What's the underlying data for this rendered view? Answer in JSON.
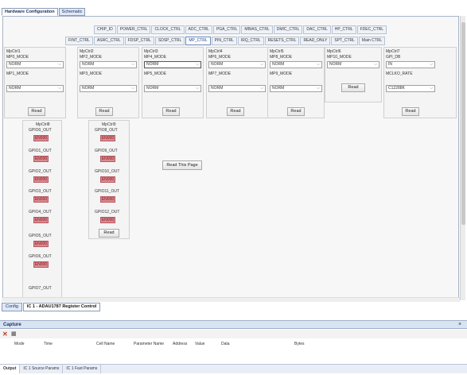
{
  "top_tabs": [
    "Hardware Configuration",
    "Schematic"
  ],
  "reg_tabs_row1": [
    "CHIP_ID",
    "POWER_CTRL",
    "CLOCK_CTRL",
    "ADC_CTRL",
    "PGA_CTRL",
    "MBIAS_CTRL",
    "DMIC_CTRL",
    "DAC_CTRL",
    "HP_CTRL",
    "FDEC_CTRL"
  ],
  "reg_tabs_row2": [
    "FINT_CTRL",
    "ASRC_CTRL",
    "FDSP_CTRL",
    "SDSP_CTRL",
    "MP_CTRL",
    "PIN_CTRL",
    "IRQ_CTRL",
    "RESETS_CTRL",
    "READ_ONLY",
    "SPT_CTRL",
    "Main CTRL"
  ],
  "mpctrl": [
    {
      "title": "MpCtrl1",
      "top_label": "MP0_MODE",
      "top_value": "NORM",
      "bot_label": "MP1_MODE",
      "bot_value": "NORM",
      "btn": "Read"
    },
    {
      "title": "MpCtrl2",
      "top_label": "MP2_MODE",
      "top_value": "NORM",
      "bot_label": "MP3_MODE",
      "bot_value": "NORM",
      "btn": "Read"
    },
    {
      "title": "MpCtrl3",
      "top_label": "MP4_MODE",
      "top_value": "NORM",
      "bot_label": "MP5_MODE",
      "bot_value": "NORM",
      "btn": "Read"
    },
    {
      "title": "MpCtrl4",
      "top_label": "MP6_MODE",
      "top_value": "NORM",
      "bot_label": "MP7_MODE",
      "bot_value": "NORM",
      "btn": "Read"
    },
    {
      "title": "MpCtrl5",
      "top_label": "MP8_MODE",
      "top_value": "NORM",
      "bot_label": "MP9_MODE",
      "bot_value": "NORM",
      "btn": "Read"
    },
    {
      "title": "MpCtrl6",
      "top_label": "MP10_MODE",
      "top_value": "NORM",
      "btn": "Read"
    },
    {
      "title": "MpCtrl7",
      "top_label": "GPI_DB",
      "top_value": "IN",
      "bot_label": "MCLKO_RATE",
      "bot_value": "C12288K",
      "btn": "Read"
    }
  ],
  "mpctrl8": {
    "title": "MpCtrl8",
    "items": [
      {
        "label": "GPIO0_OUT",
        "value": "EN000"
      },
      {
        "label": "GPIO1_OUT",
        "value": "EN000"
      },
      {
        "label": "GPIO2_OUT",
        "value": "EN000"
      },
      {
        "label": "GPIO3_OUT",
        "value": "EN000"
      },
      {
        "label": "GPIO4_OUT",
        "value": "EN000"
      },
      {
        "label": "GPIO5_OUT",
        "value": "EN000"
      },
      {
        "label": "GPIO6_OUT",
        "value": "EN000"
      },
      {
        "label": "GPIO7_OUT",
        "value": ""
      }
    ]
  },
  "mpctrl9": {
    "title": "MpCtrl9",
    "items": [
      {
        "label": "GPIO8_OUT",
        "value": "EN000"
      },
      {
        "label": "GPIO9_OUT",
        "value": "EN000"
      },
      {
        "label": "GPIO10_OUT",
        "value": "EN000"
      },
      {
        "label": "GPIO11_OUT",
        "value": "EN000"
      },
      {
        "label": "GPIO12_OUT",
        "value": "EN000"
      }
    ],
    "btn": "Read"
  },
  "read_page_btn": "Read This Page",
  "bottom_tabs": [
    "Config",
    "IC 1 - ADAU1787 Register Control"
  ],
  "caption": {
    "title": "Capture",
    "pin_glyph": "×",
    "columns": [
      "Mode",
      "Time",
      "Cell Name",
      "Parameter Name",
      "Address",
      "Value",
      "Data",
      "Bytes"
    ]
  },
  "output_tabs": [
    "Output",
    "IC 1 Source Params",
    "IC 1 Fast Params"
  ],
  "colors": {
    "accent": "#1a3c8a",
    "enable_badge": "#d98b90"
  }
}
